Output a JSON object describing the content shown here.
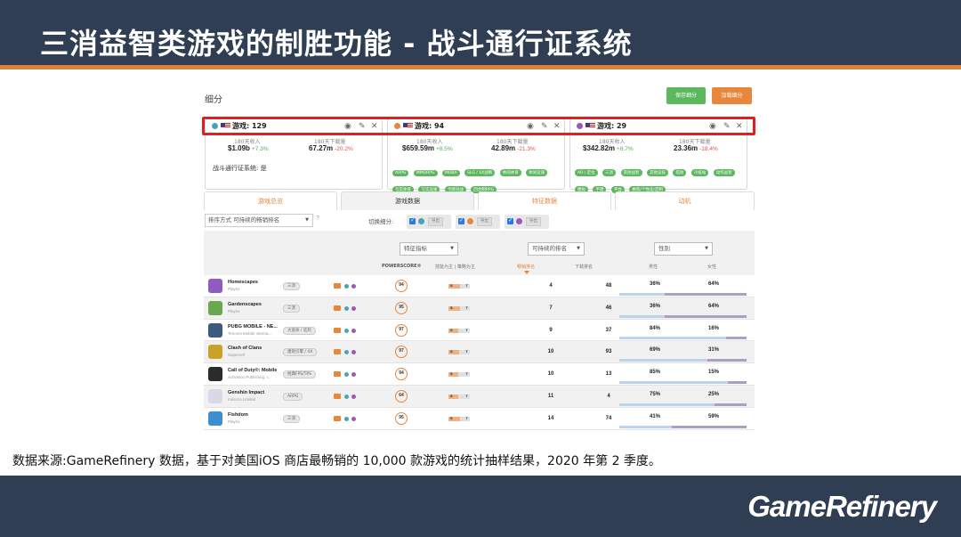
{
  "slide": {
    "title": "三消益智类游戏的制胜功能 - 战斗通行证系统",
    "source": "数据来源:GameRefinery 数据，基于对美国iOS 商店最畅销的 10,000 款游戏的统计抽样结果，2020 年第 2 季度。",
    "logo": "GameRefinery"
  },
  "colors": {
    "accent": "#e8863b",
    "header_bg": "#2f3e53",
    "highlight_box": "#e02020",
    "tag_green": "#5cb85c"
  },
  "app": {
    "section_label": "细分",
    "save_button": "保存细分",
    "add_button": "加载细分"
  },
  "segments": [
    {
      "dot_color": "#4aa3b5",
      "label": "游戏: 129",
      "stat1_label": "180天收入",
      "stat1_value": "$1.09b",
      "stat1_change": "+7.3%",
      "stat2_label": "180天下载量",
      "stat2_value": "67.27m",
      "stat2_change": "-20.2%",
      "note": "战斗通行证系统: 是"
    },
    {
      "dot_color": "#e8863b",
      "label": "游戏: 94",
      "stat1_label": "180天收入",
      "stat1_value": "$659.59m",
      "stat1_change": "+8.5%",
      "stat2_label": "180天下载量",
      "stat2_value": "42.89m",
      "stat2_change": "-21.3%",
      "tags": [
        "ARPG",
        "MMORPG",
        "MOBA",
        "SLG / 4X战略",
        "休闲体育",
        "休闲竞速",
        "写实体育",
        "写实竞速",
        "卡牌对战",
        "回合制RPG"
      ]
    },
    {
      "dot_color": "#9b59b6",
      "label": "游戏: 29",
      "stat1_label": "180天收入",
      "stat1_value": "$342.82m",
      "stat1_change": "+8.7%",
      "stat2_label": "180天下载量",
      "stat2_value": "23.36m",
      "stat2_change": "-18.4%",
      "tags": [
        "AR / 定位",
        "三消",
        "其他益智",
        "其他竞技",
        "塔防",
        "冷核站",
        "动作益智",
        "模拟",
        "宇建",
        "平台",
        "换装/个性化/定制"
      ]
    }
  ],
  "tabs": [
    "游戏总览",
    "游戏数据",
    "特征数据",
    "动机"
  ],
  "active_tab": "游戏数据",
  "controls": {
    "sort_select": "排序方式 可持续的畅销排名",
    "help": "?",
    "switch_label": "切换细分:",
    "export_label": "导出",
    "feature_select": "特征指标",
    "rank_select": "可持续的排名",
    "gender_select": "性别"
  },
  "columns": {
    "powerscore": "POWERSCORE®",
    "feature_split": "技能为主 | 策略为主",
    "grossing": "畅销排名",
    "downloads": "下载排名",
    "male": "男性",
    "female": "女性"
  },
  "games": [
    {
      "name": "Homescapes",
      "publisher": "Playrix",
      "genre": "三消",
      "score": "94",
      "skill": 0.55,
      "grossing": "4",
      "downloads": "48",
      "male": "36%",
      "female": "64%",
      "male_share": 0.36,
      "icon_color": "#8e5cc4"
    },
    {
      "name": "Gardenscapes",
      "publisher": "Playrix",
      "genre": "三消",
      "score": "95",
      "skill": 0.55,
      "grossing": "7",
      "downloads": "46",
      "male": "36%",
      "female": "64%",
      "male_share": 0.36,
      "icon_color": "#6aa84f"
    },
    {
      "name": "PUBG MOBILE - NE...",
      "publisher": "Tencent Mobile Interna...",
      "genre": "大逃杀 / 吃鸡",
      "score": "97",
      "skill": 0.45,
      "grossing": "9",
      "downloads": "37",
      "male": "84%",
      "female": "16%",
      "male_share": 0.84,
      "icon_color": "#3d5a80"
    },
    {
      "name": "Clash of Clans",
      "publisher": "Supercell",
      "genre": "建筑引擎 / 4X",
      "score": "97",
      "skill": 0.5,
      "grossing": "10",
      "downloads": "93",
      "male": "69%",
      "female": "31%",
      "male_share": 0.69,
      "icon_color": "#c9a227"
    },
    {
      "name": "Call of Duty®: Mobile",
      "publisher": "Activision Publishing, I...",
      "genre": "经典FPS/TPS",
      "score": "94",
      "skill": 0.45,
      "grossing": "10",
      "downloads": "13",
      "male": "85%",
      "female": "15%",
      "male_share": 0.85,
      "icon_color": "#2b2b2b"
    },
    {
      "name": "Genshin Impact",
      "publisher": "miHoYo Limited",
      "genre": "ARPG",
      "score": "64",
      "skill": 0.45,
      "grossing": "11",
      "downloads": "4",
      "male": "75%",
      "female": "25%",
      "male_share": 0.75,
      "icon_color": "#d9d9e6"
    },
    {
      "name": "Fishdom",
      "publisher": "Playrix",
      "genre": "三消",
      "score": "95",
      "skill": 0.55,
      "grossing": "14",
      "downloads": "74",
      "male": "41%",
      "female": "59%",
      "male_share": 0.41,
      "icon_color": "#3b8fd1"
    }
  ]
}
